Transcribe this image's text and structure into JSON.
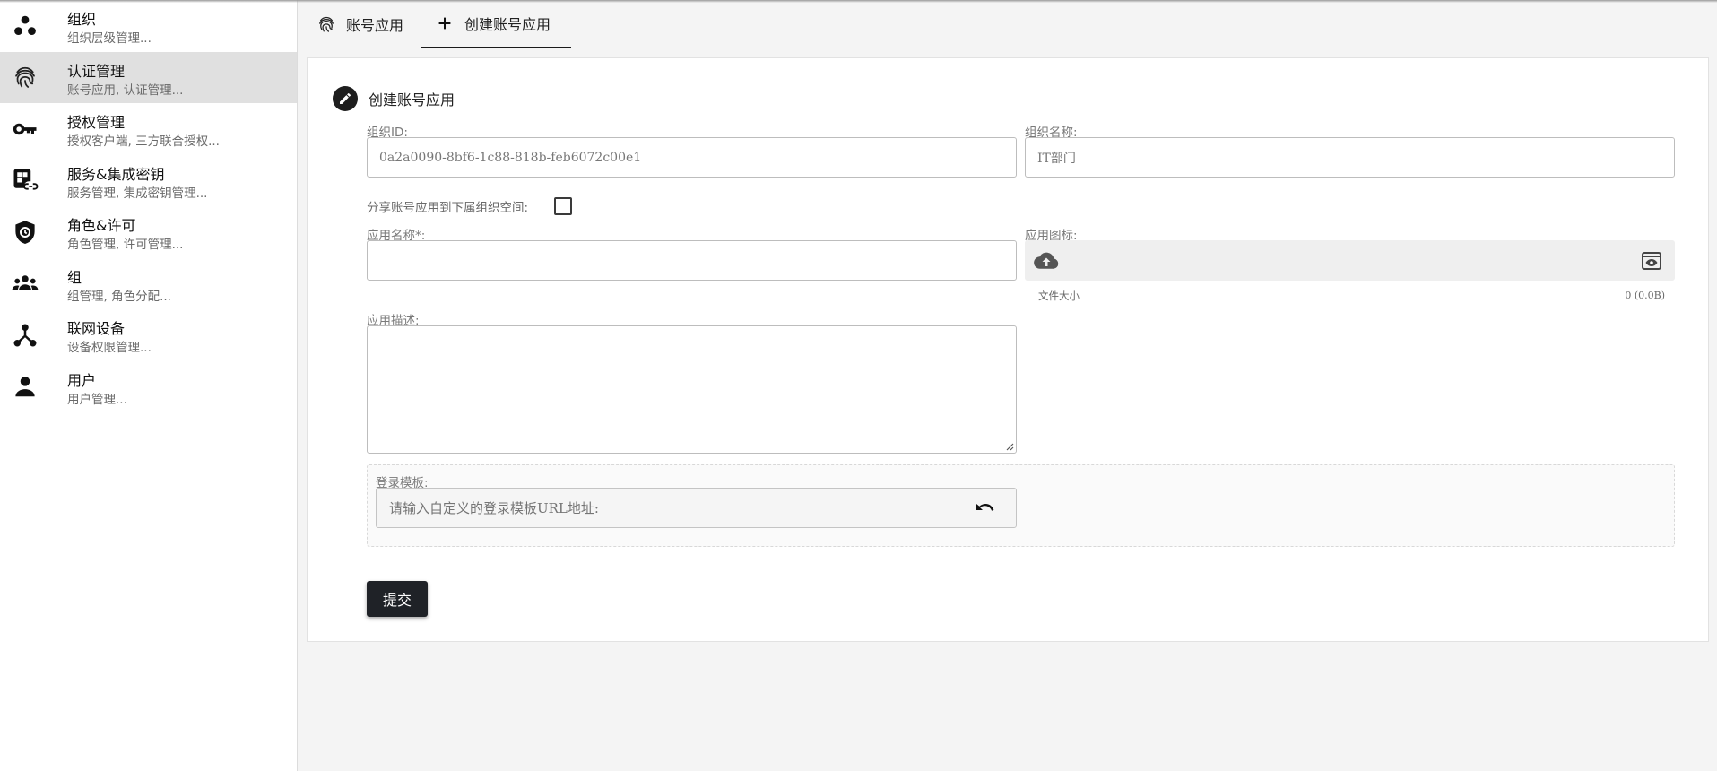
{
  "sidebar": {
    "items": [
      {
        "title": "组织",
        "sub": "组织层级管理...",
        "icon": "organization-icon"
      },
      {
        "title": "认证管理",
        "sub": "账号应用, 认证管理...",
        "icon": "fingerprint-icon"
      },
      {
        "title": "授权管理",
        "sub": "授权客户端, 三方联合授权...",
        "icon": "key-icon"
      },
      {
        "title": "服务&集成密钥",
        "sub": "服务管理, 集成密钥管理...",
        "icon": "service-link-icon"
      },
      {
        "title": "角色&许可",
        "sub": "角色管理, 许可管理...",
        "icon": "shield-icon"
      },
      {
        "title": "组",
        "sub": "组管理, 角色分配...",
        "icon": "group-icon"
      },
      {
        "title": "联网设备",
        "sub": "设备权限管理...",
        "icon": "network-device-icon"
      },
      {
        "title": "用户",
        "sub": "用户管理...",
        "icon": "user-icon"
      }
    ],
    "active_index": 1
  },
  "tabs": [
    {
      "label": "账号应用",
      "icon": "fingerprint-icon"
    },
    {
      "label": "创建账号应用",
      "icon": "plus-icon"
    }
  ],
  "form": {
    "heading": "创建账号应用",
    "org_id_label": "组织ID:",
    "org_id_value": "0a2a0090-8bf6-1c88-818b-feb6072c00e1",
    "org_name_label": "组织名称:",
    "org_name_value": "IT部门",
    "share_label": "分享账号应用到下属组织空间:",
    "share_checked": false,
    "app_name_label": "应用名称*:",
    "app_name_value": "",
    "app_icon_label": "应用图标:",
    "file_size_label": "文件大小",
    "file_size_value": "0 (0.0B)",
    "desc_label": "应用描述:",
    "desc_value": "",
    "template_label": "登录模板:",
    "template_placeholder": "请输入自定义的登录模板URL地址:",
    "submit_label": "提交"
  },
  "colors": {
    "active_nav_bg": "#e0e0e0",
    "submit_bg": "#1f2227",
    "main_bg": "#f4f4f4"
  }
}
